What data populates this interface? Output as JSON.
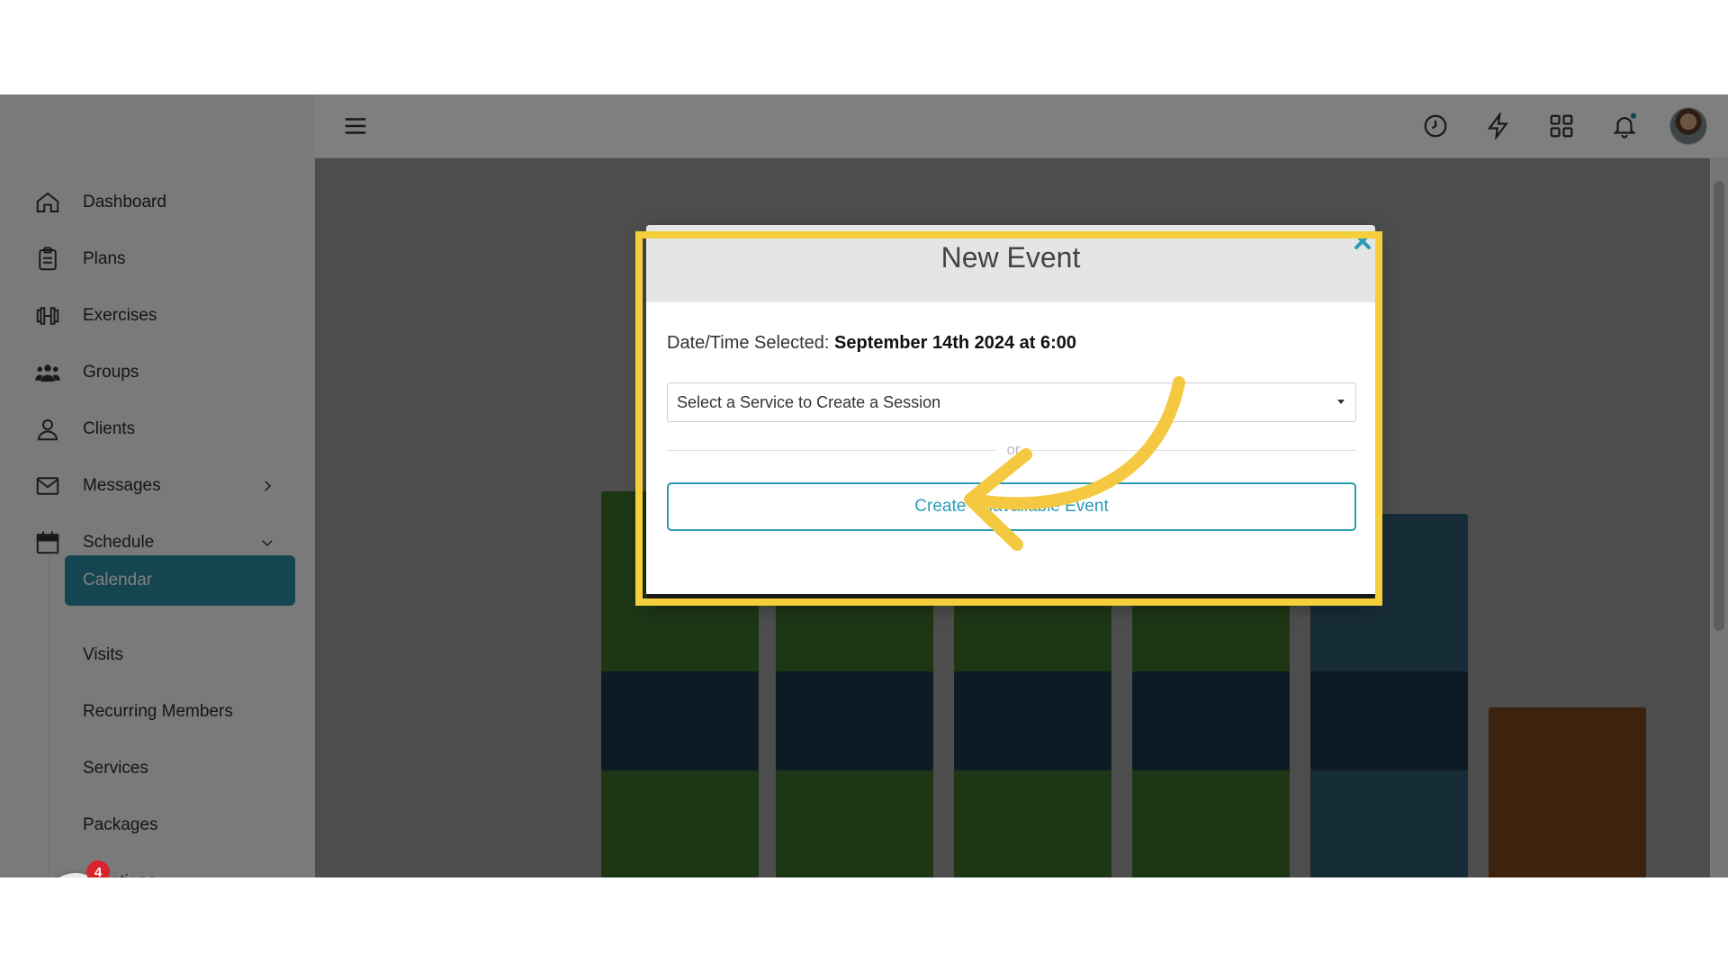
{
  "sidebar": {
    "items": [
      {
        "label": "Dashboard",
        "icon": "home-icon"
      },
      {
        "label": "Plans",
        "icon": "clipboard-icon"
      },
      {
        "label": "Exercises",
        "icon": "dumbbell-icon"
      },
      {
        "label": "Groups",
        "icon": "users-icon"
      },
      {
        "label": "Clients",
        "icon": "user-icon"
      },
      {
        "label": "Messages",
        "icon": "envelope-icon"
      },
      {
        "label": "Schedule",
        "icon": "calendar-icon"
      }
    ],
    "schedule_children": [
      "Calendar",
      "Visits",
      "Recurring Members",
      "Services",
      "Packages",
      "Locations"
    ],
    "active_child": "Calendar"
  },
  "topbar": {
    "icons": [
      "menu-icon",
      "clock-icon",
      "lightning-icon",
      "grid-icon",
      "bell-icon",
      "avatar"
    ]
  },
  "modal": {
    "title": "New Event",
    "date_label": "Date/Time Selected:",
    "date_value": "September 14th 2024 at 6:00",
    "service_placeholder": "Select a Service to Create a Session",
    "or_text": "or",
    "unavailable_button": "Create Unavailable Event"
  },
  "widget": {
    "badge_count": "4"
  },
  "colors": {
    "accent": "#2a8aa3",
    "highlight": "#f5cf3a",
    "badge": "#d9232d"
  }
}
